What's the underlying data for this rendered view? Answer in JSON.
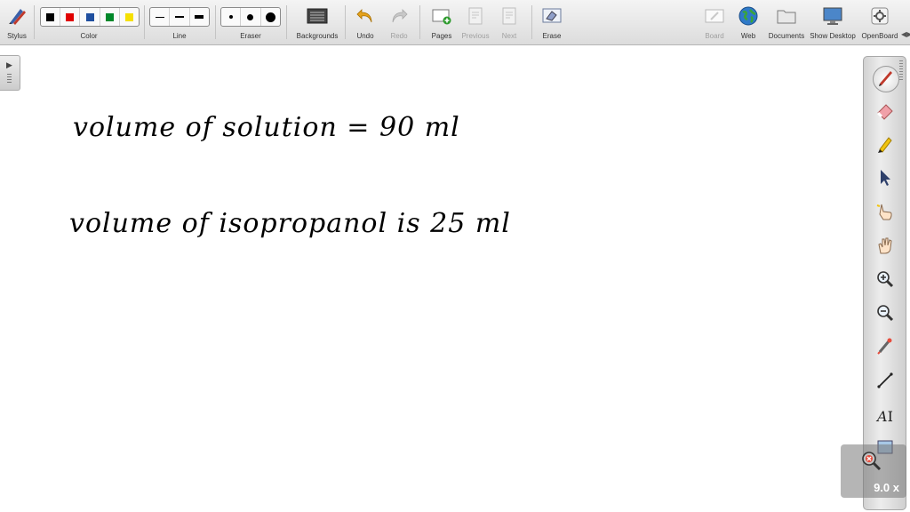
{
  "toolbar": {
    "stylus": "Stylus",
    "color": "Color",
    "line": "Line",
    "eraser": "Eraser",
    "backgrounds": "Backgrounds",
    "undo": "Undo",
    "redo": "Redo",
    "pages": "Pages",
    "previous": "Previous",
    "next": "Next",
    "erase": "Erase",
    "board": "Board",
    "web": "Web",
    "documents": "Documents",
    "show_desktop": "Show Desktop",
    "openboard": "OpenBoard"
  },
  "palette_colors": [
    "#000000",
    "#e00000",
    "#1f4f9f",
    "#00882a",
    "#f5e000"
  ],
  "board": {
    "line1": "volume of solution = 90 ml",
    "line2": "volume of isopropanol is 25 ml"
  },
  "zoom": {
    "label": "9.0 x"
  },
  "right_tools": [
    "pen-icon",
    "eraser-icon",
    "marker-icon",
    "selector-icon",
    "interactor-icon",
    "hand-icon",
    "zoom-in-icon",
    "zoom-out-icon",
    "laser-pointer-icon",
    "line-icon",
    "text-icon",
    "capture-icon"
  ]
}
